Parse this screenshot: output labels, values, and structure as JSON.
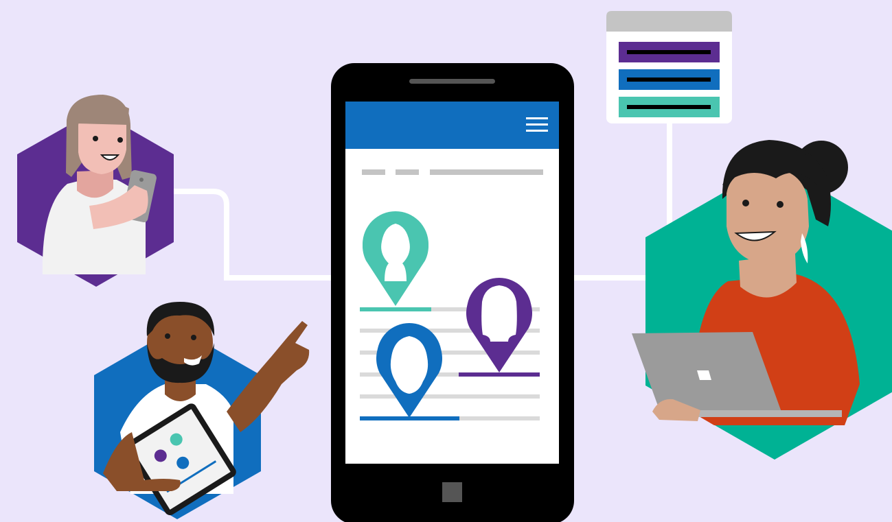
{
  "scene": {
    "colors": {
      "background": "#ebe5fb",
      "purple": "#5c2d91",
      "blue": "#106ebe",
      "teal": "#4ac5b0",
      "dark_teal": "#00b294",
      "orange_shirt": "#d13f16",
      "gray": "#c4c4c4",
      "line": "#ffffff"
    },
    "phone": {
      "screen_header_color": "#106ebe",
      "menu_icon": "hamburger-icon",
      "home_button_icon": "square-icon",
      "location_pins": [
        {
          "name": "teal-pin",
          "color": "#4ac5b0",
          "underline_progress": 0.4
        },
        {
          "name": "purple-pin",
          "color": "#5c2d91",
          "underline_progress": 0.45
        },
        {
          "name": "blue-pin",
          "color": "#106ebe",
          "underline_progress": 0.55
        }
      ]
    },
    "floating_card": {
      "rows": [
        "#5c2d91",
        "#106ebe",
        "#4ac5b0"
      ]
    },
    "people": [
      {
        "name": "woman-with-phone",
        "hex_color": "#5c2d91",
        "device": "phone-icon"
      },
      {
        "name": "man-with-tablet",
        "hex_color": "#106ebe",
        "device": "tablet-icon"
      },
      {
        "name": "woman-with-laptop",
        "hex_color": "#00b294",
        "device": "laptop-icon"
      }
    ]
  }
}
